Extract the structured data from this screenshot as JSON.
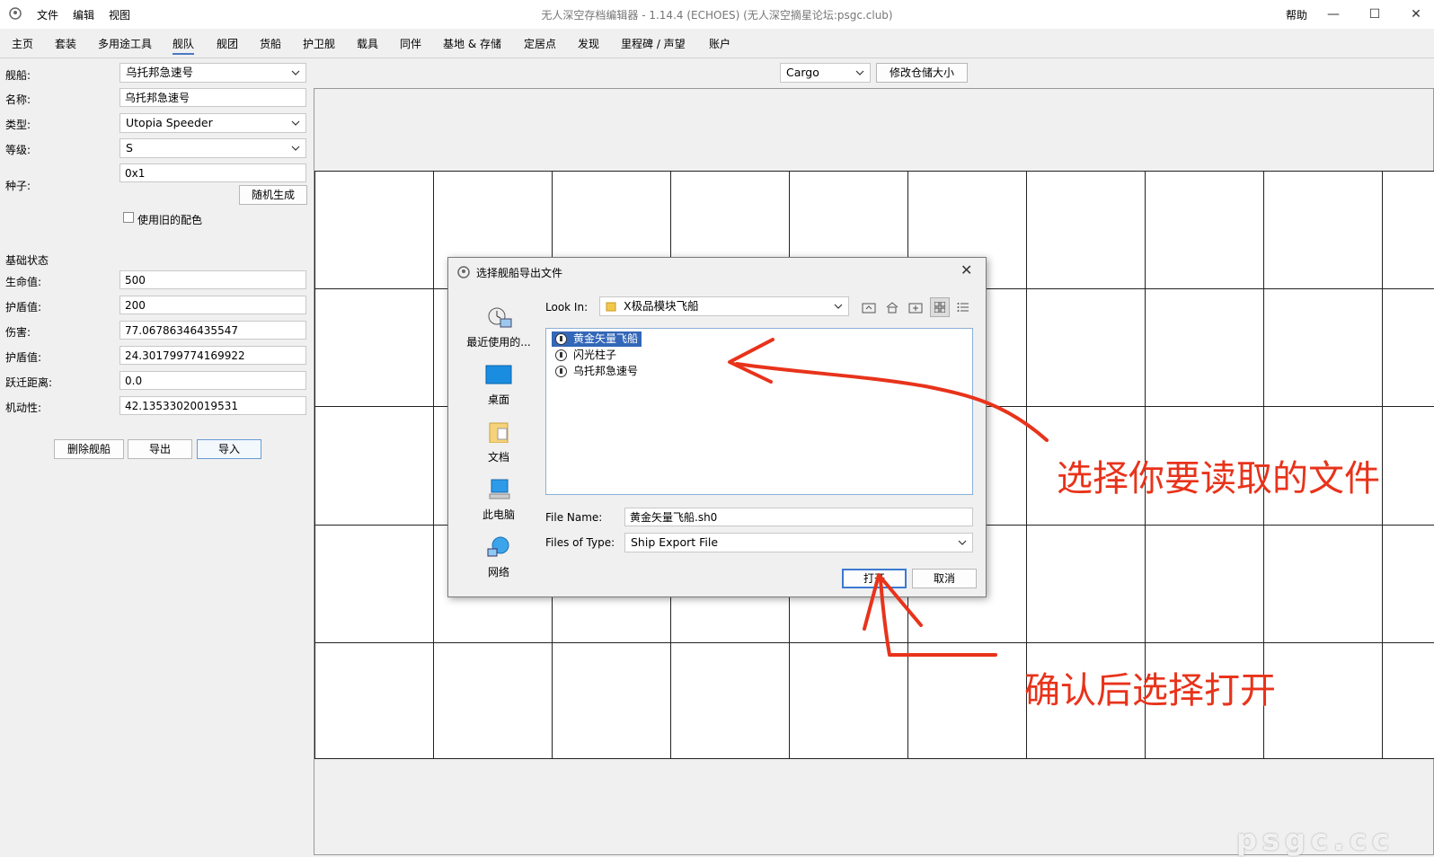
{
  "window": {
    "title": "无人深空存档编辑器 - 1.14.4 (ECHOES) (无人深空摘星论坛:psgc.club)",
    "menu": [
      "文件",
      "编辑",
      "视图"
    ],
    "help": "帮助",
    "minimize": "—",
    "maximize": "☐",
    "close": "✕"
  },
  "tabs": [
    "主页",
    "套装",
    "多用途工具",
    "舰队",
    "舰团",
    "货船",
    "护卫舰",
    "载具",
    "同伴",
    "基地 & 存储",
    "定居点",
    "发现",
    "里程碑 / 声望",
    "账户"
  ],
  "active_tab": "舰队",
  "form": {
    "ship_label": "舰船:",
    "ship_value": "乌托邦急速号",
    "name_label": "名称:",
    "name_value": "乌托邦急速号",
    "type_label": "类型:",
    "type_value": "Utopia Speeder",
    "class_label": "等级:",
    "class_value": "S",
    "seed_label": "种子:",
    "seed_value": "0x1",
    "random_button": "随机生成",
    "old_colors_label": "使用旧的配色",
    "base_stats_heading": "基础状态",
    "health_label": "生命值:",
    "health_value": "500",
    "shield_label": "护盾值:",
    "shield_value": "200",
    "damage_label": "伤害:",
    "damage_value": "77.06786346435547",
    "shield2_label": "护盾值:",
    "shield2_value": "24.301799774169922",
    "warp_label": "跃迁距离:",
    "warp_value": "0.0",
    "maneuver_label": "机动性:",
    "maneuver_value": "42.13533020019531",
    "delete_button": "删除舰船",
    "export_button": "导出",
    "import_button": "导入"
  },
  "inventory": {
    "select_value": "Cargo",
    "resize_button": "修改仓储大小"
  },
  "dialog": {
    "title": "选择舰船导出文件",
    "look_in_label": "Look In:",
    "look_in_value": "X极品模块飞船",
    "places": [
      "最近使用的...",
      "桌面",
      "文档",
      "此电脑",
      "网络"
    ],
    "files": [
      "黄金矢量飞船",
      "闪光柱子",
      "乌托邦急速号"
    ],
    "file_name_label": "File Name:",
    "file_name_value": "黄金矢量飞船.sh0",
    "file_type_label": "Files of Type:",
    "file_type_value": "Ship Export File",
    "open_button": "打开",
    "cancel_button": "取消"
  },
  "annotations": {
    "select_file": "选择你要读取的文件",
    "confirm_open": "确认后选择打开",
    "color": "#e8331b"
  },
  "watermark": "psgc.cc"
}
